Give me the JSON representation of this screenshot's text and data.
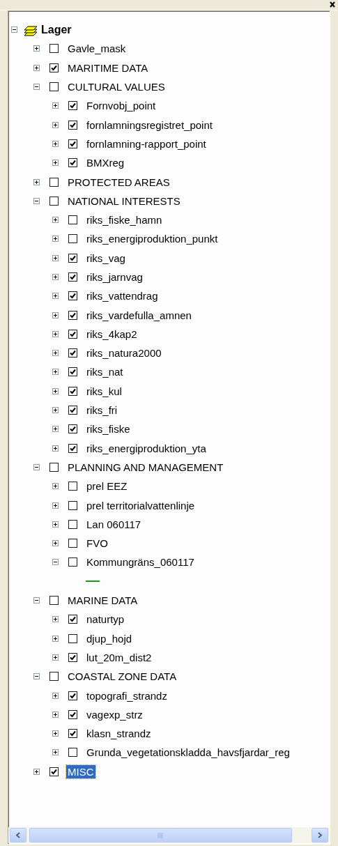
{
  "tree": {
    "label": "Lager",
    "expanded": true,
    "children": [
      {
        "label": "Gavle_mask",
        "checked": false,
        "expanded": false,
        "selected": false
      },
      {
        "label": "MARITIME DATA",
        "checked": true,
        "expanded": false,
        "selected": false
      },
      {
        "label": "CULTURAL VALUES",
        "checked": false,
        "expanded": true,
        "selected": false,
        "children": [
          {
            "label": "Fornvobj_point",
            "checked": true,
            "expanded": false,
            "selected": false
          },
          {
            "label": "fornlamningsregistret_point",
            "checked": true,
            "expanded": false,
            "selected": false
          },
          {
            "label": "fornlamning-rapport_point",
            "checked": true,
            "expanded": false,
            "selected": false
          },
          {
            "label": "BMXreg",
            "checked": true,
            "expanded": false,
            "selected": false
          }
        ]
      },
      {
        "label": "PROTECTED AREAS",
        "checked": false,
        "expanded": false,
        "selected": false
      },
      {
        "label": "NATIONAL INTERESTS",
        "checked": false,
        "expanded": true,
        "selected": false,
        "children": [
          {
            "label": "riks_fiske_hamn",
            "checked": false,
            "expanded": false,
            "selected": false
          },
          {
            "label": "riks_energiproduktion_punkt",
            "checked": false,
            "expanded": false,
            "selected": false
          },
          {
            "label": "riks_vag",
            "checked": true,
            "expanded": false,
            "selected": false
          },
          {
            "label": "riks_jarnvag",
            "checked": true,
            "expanded": false,
            "selected": false
          },
          {
            "label": "riks_vattendrag",
            "checked": true,
            "expanded": false,
            "selected": false
          },
          {
            "label": "riks_vardefulla_amnen",
            "checked": true,
            "expanded": false,
            "selected": false
          },
          {
            "label": "riks_4kap2",
            "checked": true,
            "expanded": false,
            "selected": false
          },
          {
            "label": "riks_natura2000",
            "checked": true,
            "expanded": false,
            "selected": false
          },
          {
            "label": "riks_nat",
            "checked": true,
            "expanded": false,
            "selected": false
          },
          {
            "label": "riks_kul",
            "checked": true,
            "expanded": false,
            "selected": false
          },
          {
            "label": "riks_fri",
            "checked": true,
            "expanded": false,
            "selected": false
          },
          {
            "label": "riks_fiske",
            "checked": true,
            "expanded": false,
            "selected": false
          },
          {
            "label": "riks_energiproduktion_yta",
            "checked": true,
            "expanded": false,
            "selected": false
          }
        ]
      },
      {
        "label": "PLANNING AND MANAGEMENT",
        "checked": false,
        "expanded": true,
        "selected": false,
        "children": [
          {
            "label": "prel EEZ",
            "checked": false,
            "expanded": false,
            "selected": false
          },
          {
            "label": "prel territorialvattenlinje",
            "checked": false,
            "expanded": false,
            "selected": false
          },
          {
            "label": "Lan 060117",
            "checked": false,
            "expanded": false,
            "selected": false
          },
          {
            "label": "FVO",
            "checked": false,
            "expanded": false,
            "selected": false
          },
          {
            "label": "Kommungräns_060117",
            "checked": false,
            "expanded": true,
            "selected": false,
            "children": [
              {
                "kind": "line-symbol",
                "color": "#1a9a1a"
              }
            ]
          }
        ]
      },
      {
        "label": "MARINE DATA",
        "checked": false,
        "expanded": true,
        "selected": false,
        "children": [
          {
            "label": "naturtyp",
            "checked": true,
            "expanded": false,
            "selected": false
          },
          {
            "label": "djup_hojd",
            "checked": false,
            "expanded": false,
            "selected": false
          },
          {
            "label": "lut_20m_dist2",
            "checked": true,
            "expanded": false,
            "selected": false
          }
        ]
      },
      {
        "label": "COASTAL ZONE DATA",
        "checked": false,
        "expanded": true,
        "selected": false,
        "children": [
          {
            "label": "topografi_strandz",
            "checked": true,
            "expanded": false,
            "selected": false
          },
          {
            "label": "vagexp_strz",
            "checked": true,
            "expanded": false,
            "selected": false
          },
          {
            "label": "klasn_strandz",
            "checked": true,
            "expanded": false,
            "selected": false
          },
          {
            "label": "Grunda_vegetationskladda_havsfjardar_reg",
            "checked": false,
            "expanded": false,
            "selected": false
          }
        ]
      },
      {
        "label": "MISC",
        "checked": true,
        "expanded": false,
        "selected": true
      }
    ]
  }
}
